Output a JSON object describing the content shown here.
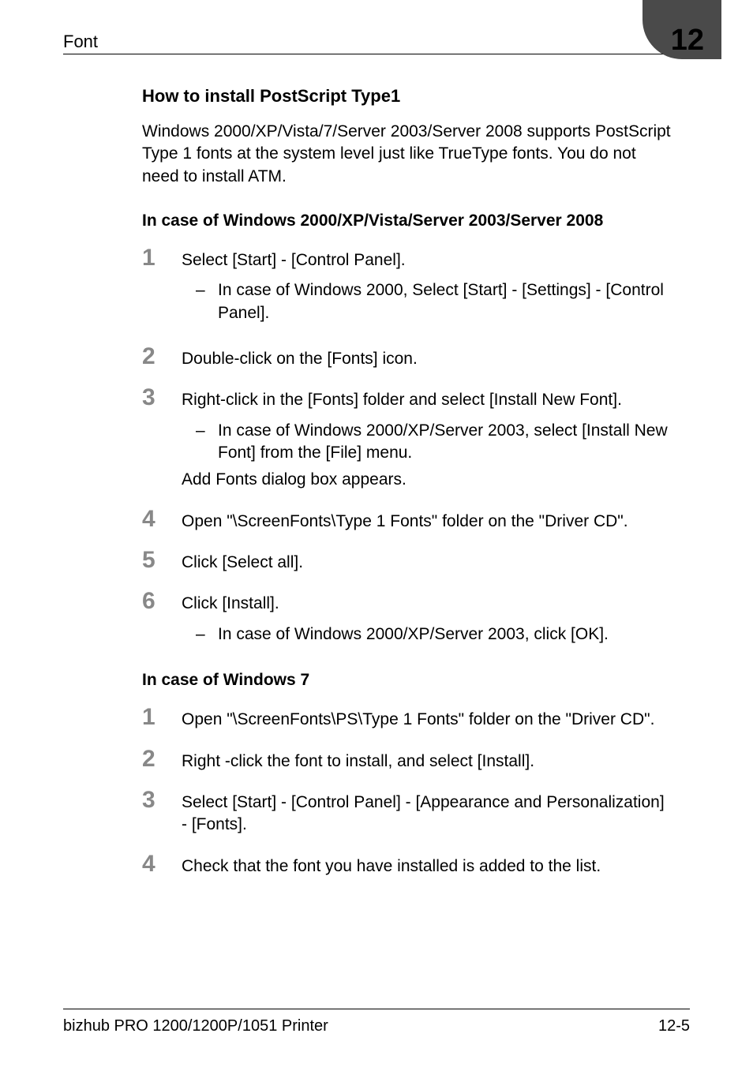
{
  "header": {
    "left": "Font",
    "chapter_number": "12"
  },
  "section1": {
    "title": "How to install PostScript Type1",
    "para": "Windows 2000/XP/Vista/7/Server 2003/Server 2008 supports PostScript Type 1 fonts at the system level just like TrueType fonts. You do not need to install ATM."
  },
  "subsectionA": {
    "title": "In case of Windows 2000/XP/Vista/Server 2003/Server 2008",
    "steps": [
      {
        "num": "1",
        "text": "Select [Start] - [Control Panel].",
        "subs": [
          "In case of Windows 2000, Select [Start] - [Settings] - [Control Panel]."
        ]
      },
      {
        "num": "2",
        "text": "Double-click on the [Fonts] icon."
      },
      {
        "num": "3",
        "text": "Right-click in the [Fonts] folder and select [Install New Font].",
        "subs": [
          "In case of Windows 2000/XP/Server 2003, select [Install New Font] from the [File] menu."
        ],
        "after": "Add Fonts dialog box appears."
      },
      {
        "num": "4",
        "text": "Open \"\\ScreenFonts\\Type 1 Fonts\" folder on the \"Driver CD\"."
      },
      {
        "num": "5",
        "text": "Click [Select all]."
      },
      {
        "num": "6",
        "text": "Click [Install].",
        "subs": [
          "In case of Windows 2000/XP/Server 2003, click [OK]."
        ]
      }
    ]
  },
  "subsectionB": {
    "title": "In case of Windows 7",
    "steps": [
      {
        "num": "1",
        "text": "Open \"\\ScreenFonts\\PS\\Type 1 Fonts\" folder on the \"Driver CD\"."
      },
      {
        "num": "2",
        "text": "Right -click the font to install, and select [Install]."
      },
      {
        "num": "3",
        "text": "Select [Start] - [Control Panel] - [Appearance and Personalization] - [Fonts]."
      },
      {
        "num": "4",
        "text": "Check that the font you have installed is added to the list."
      }
    ]
  },
  "footer": {
    "left": "bizhub PRO 1200/1200P/1051 Printer",
    "right": "12-5"
  }
}
